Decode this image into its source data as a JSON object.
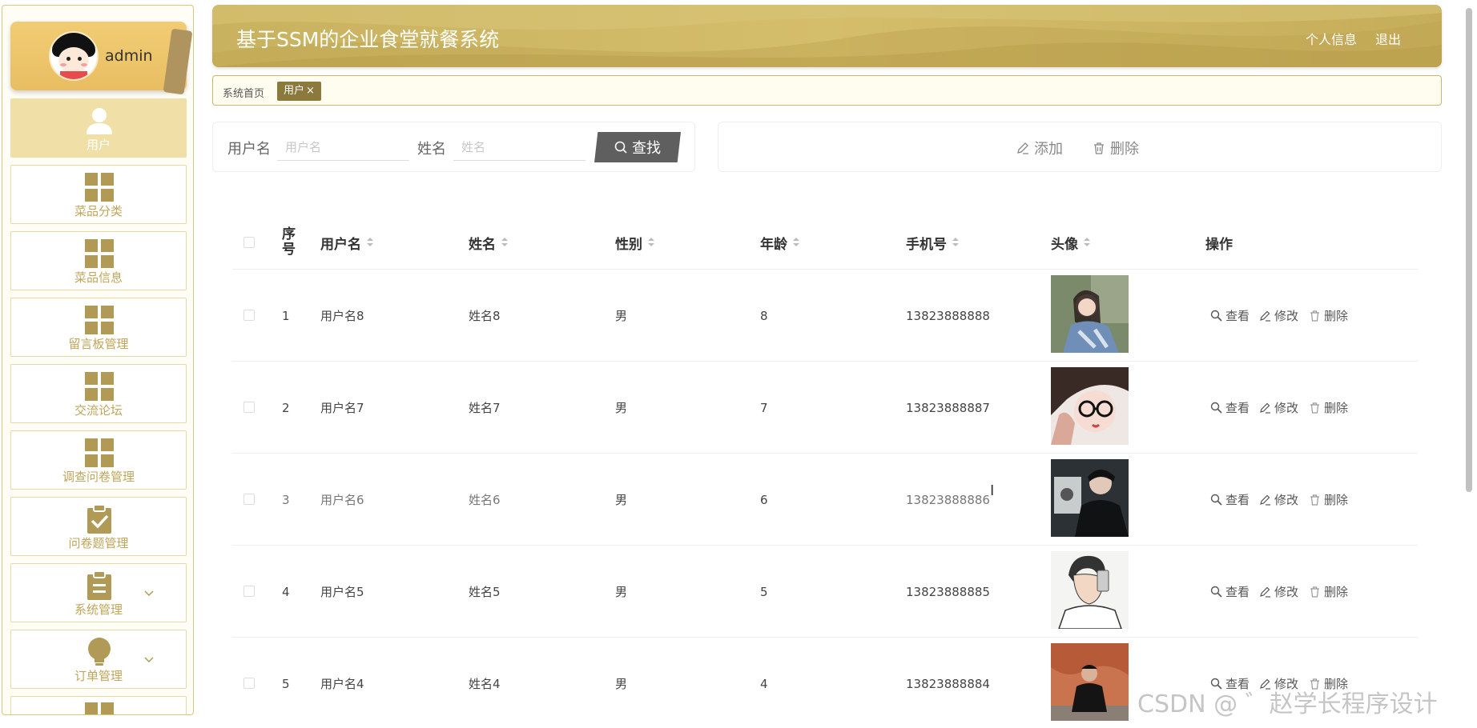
{
  "app": {
    "title": "基于SSM的企业食堂就餐系统",
    "profile_label": "个人信息",
    "logout_label": "退出",
    "theme": {
      "accent": "#c9b25f",
      "accent_dark": "#8b7a3c",
      "menu_text": "#c0a55a"
    }
  },
  "user": {
    "name": "admin"
  },
  "sidebar": {
    "items": [
      {
        "label": "用户",
        "icon": "person-icon",
        "active": true
      },
      {
        "label": "菜品分类",
        "icon": "grid-icon"
      },
      {
        "label": "菜品信息",
        "icon": "grid-icon"
      },
      {
        "label": "留言板管理",
        "icon": "grid-icon"
      },
      {
        "label": "交流论坛",
        "icon": "grid-icon"
      },
      {
        "label": "调查问卷管理",
        "icon": "grid-icon"
      },
      {
        "label": "问卷题管理",
        "icon": "clipboard-check-icon"
      },
      {
        "label": "系统管理",
        "icon": "clipboard-icon",
        "expandable": true
      },
      {
        "label": "订单管理",
        "icon": "bulb-icon",
        "expandable": true
      }
    ]
  },
  "tags": {
    "home": "系统首页",
    "active": "用户",
    "close": "×"
  },
  "search": {
    "username_label": "用户名",
    "username_placeholder": "用户名",
    "name_label": "姓名",
    "name_placeholder": "姓名",
    "find_label": "查找"
  },
  "actions": {
    "add_label": "添加",
    "delete_label": "删除"
  },
  "table": {
    "columns": [
      "序号",
      "用户名",
      "姓名",
      "性别",
      "年龄",
      "手机号",
      "头像",
      "操作"
    ],
    "row_actions": {
      "view": "查看",
      "edit": "修改",
      "delete": "删除"
    },
    "rows": [
      {
        "index": "1",
        "username": "用户名8",
        "name": "姓名8",
        "gender": "男",
        "age": "8",
        "phone": "13823888888",
        "avatar": "girl-jacket-photo"
      },
      {
        "index": "2",
        "username": "用户名7",
        "name": "姓名7",
        "gender": "男",
        "age": "7",
        "phone": "13823888887",
        "avatar": "girl-glasses-photo"
      },
      {
        "index": "3",
        "username": "用户名6",
        "name": "姓名6",
        "gender": "男",
        "age": "6",
        "phone": "13823888886",
        "avatar": "man-dark-photo"
      },
      {
        "index": "4",
        "username": "用户名5",
        "name": "姓名5",
        "gender": "男",
        "age": "5",
        "phone": "13823888885",
        "avatar": "cartoon-selfie-photo"
      },
      {
        "index": "5",
        "username": "用户名4",
        "name": "姓名4",
        "gender": "男",
        "age": "4",
        "phone": "13823888884",
        "avatar": "man-sitting-photo"
      }
    ]
  },
  "watermark": "CSDN @ ゛赵学长程序设计"
}
